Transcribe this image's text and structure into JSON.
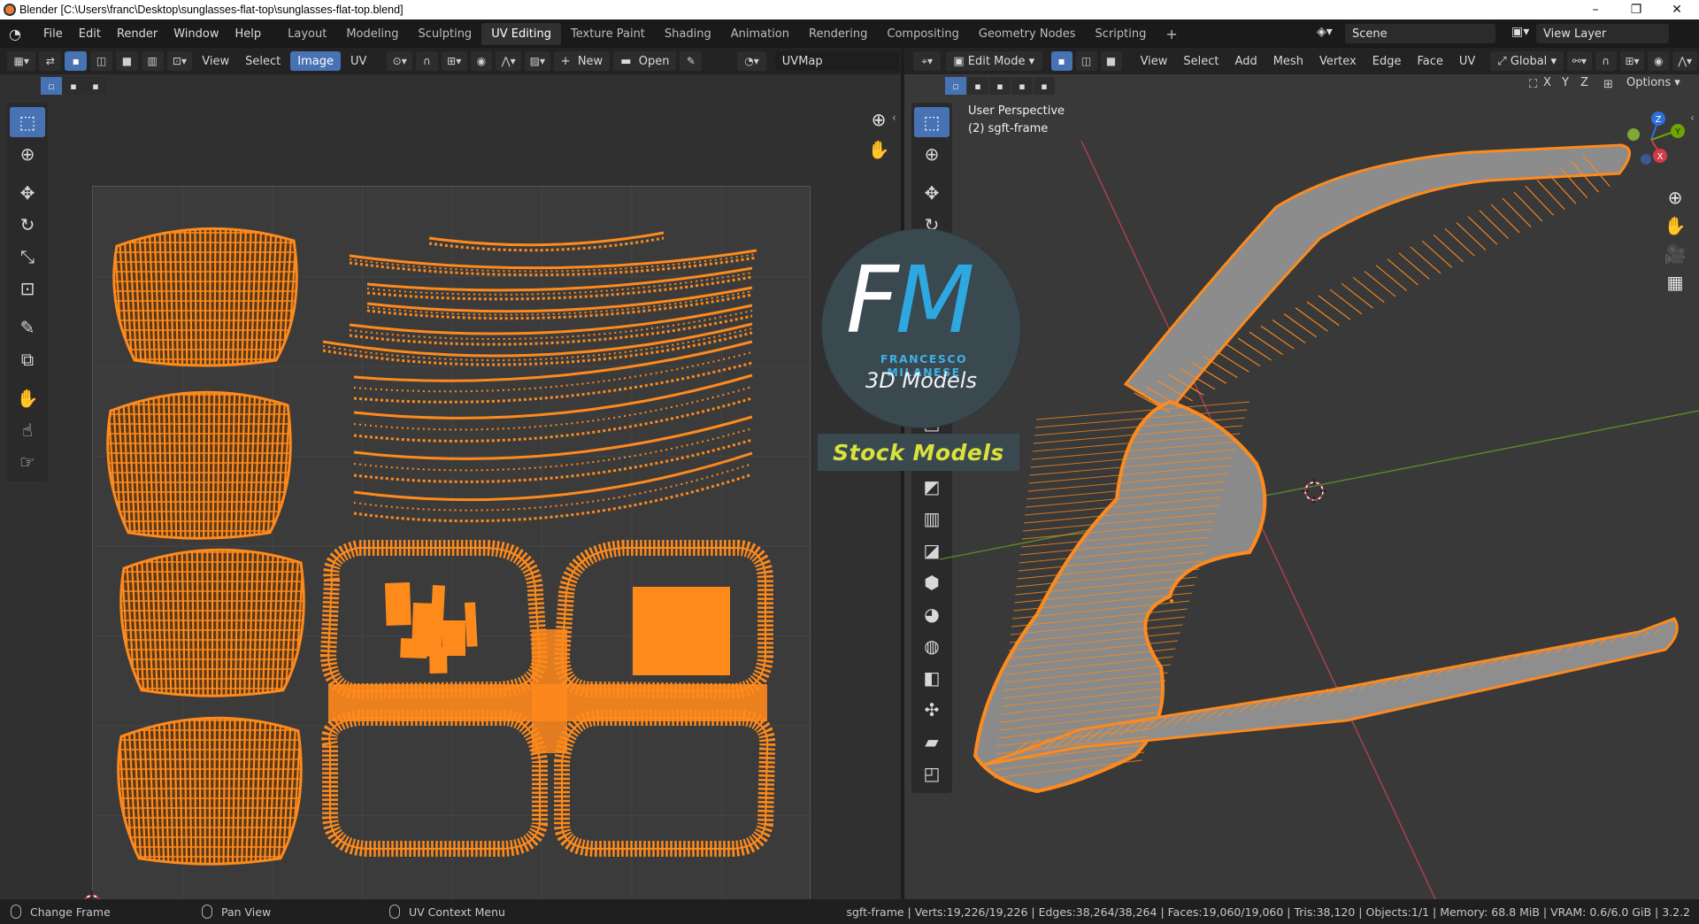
{
  "window": {
    "title": "Blender [C:\\Users\\franc\\Desktop\\sunglasses-flat-top\\sunglasses-flat-top.blend]",
    "minimize": "–",
    "maximize": "❐",
    "close": "✕"
  },
  "menu": [
    "File",
    "Edit",
    "Render",
    "Window",
    "Help"
  ],
  "workspaces": [
    "Layout",
    "Modeling",
    "Sculpting",
    "UV Editing",
    "Texture Paint",
    "Shading",
    "Animation",
    "Rendering",
    "Compositing",
    "Geometry Nodes",
    "Scripting"
  ],
  "active_workspace": "UV Editing",
  "add_workspace": "+",
  "scene": "Scene",
  "view_layer": "View Layer",
  "uv_editor": {
    "menus": [
      "View",
      "Select",
      "Image",
      "UV"
    ],
    "active_menu": "Image",
    "new_label": "New",
    "open_label": "Open",
    "uvmap": "UVMap"
  },
  "viewport": {
    "mode": "Edit Mode",
    "menus": [
      "View",
      "Select",
      "Add",
      "Mesh",
      "Vertex",
      "Edge",
      "Face",
      "UV"
    ],
    "orientation": "Global",
    "options_label": "Options",
    "axes": [
      "X",
      "Y",
      "Z"
    ],
    "view_name": "User Perspective",
    "object_name": "(2) sgft-frame",
    "gizmo": {
      "z": "Z",
      "y": "Y",
      "x": "X"
    }
  },
  "logo": {
    "f": "F",
    "m": "M",
    "name": "FRANCESCO MILANESE",
    "subtitle": "3D Models",
    "banner": "Stock Models"
  },
  "status": {
    "change_frame": "Change Frame",
    "pan_view": "Pan View",
    "context_menu": "UV Context Menu",
    "stats": "sgft-frame | Verts:19,226/19,226 | Edges:38,264/38,264 | Faces:19,060/19,060 | Tris:38,120 | Objects:1/1 | Memory: 68.8 MiB | VRAM: 0.6/6.0 GiB | 3.2.2"
  },
  "colors": {
    "accent": "#4772b3",
    "mesh": "#ff8a1c",
    "logo_blue": "#2ea8e0",
    "logo_yellow": "#d9e23a"
  }
}
